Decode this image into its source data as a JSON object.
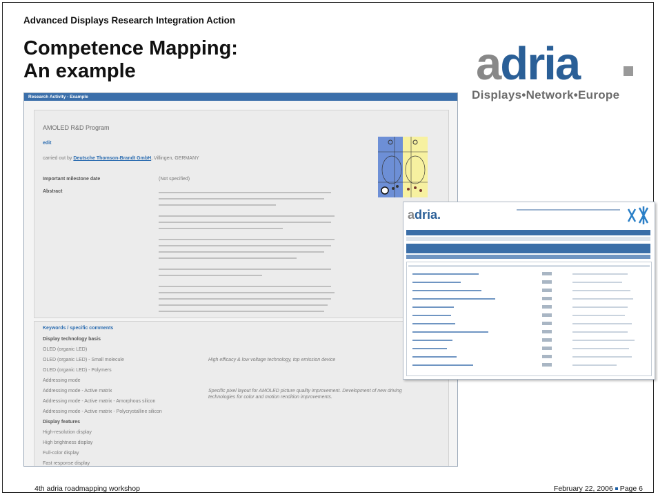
{
  "header": {
    "subtitle": "Advanced Displays Research Integration Action",
    "title_line1": "Competence Mapping:",
    "title_line2": "An example"
  },
  "logo": {
    "name_prefix": "a",
    "name_rest": "dria",
    "tagline": "Displays•Network•Europe"
  },
  "footer": {
    "left": "4th adria roadmapping workshop",
    "right_date": "February 22, 2006",
    "right_page": "Page 6"
  },
  "screenshot1": {
    "bar_title": "Research Activity - Example",
    "program_title": "AMOLED R&D Program",
    "edit": "edit",
    "carried_out_by": "carried out by",
    "company": "Deutsche Thomson-Brandt GmbH",
    "location": ", Villingen, GERMANY",
    "milestone_label": "Important milestone date",
    "milestone_value": "(Not specified)",
    "abstract_label": "Abstract",
    "keywords_title": "Keywords / specific comments",
    "kw": [
      "Display technology basis",
      "OLED (organic LED)",
      "OLED (organic LED) - Small molecule",
      "OLED (organic LED) - Polymers",
      "Addressing mode",
      "Addressing mode - Active matrix",
      "Addressing mode - Active matrix - Amorphous silicon",
      "Addressing mode - Active matrix - Polycrystalline silicon",
      "Display features",
      "High-resolution display",
      "High brightness display",
      "Full-color display",
      "Fast response display"
    ],
    "kw_comment1": "High efficacy & low voltage technology, top emission device",
    "kw_comment2a": "Specific pixel layout for AMOLED picture quality improvement. Development of new driving",
    "kw_comment2b": "technologies for color and motion rendition improvements."
  },
  "screenshot2": {
    "logo_prefix": "a",
    "logo_rest": "dria."
  },
  "colors": {
    "accent": "#3b6faa",
    "logo_blue": "#2a5f97",
    "logo_gray": "#888888"
  }
}
